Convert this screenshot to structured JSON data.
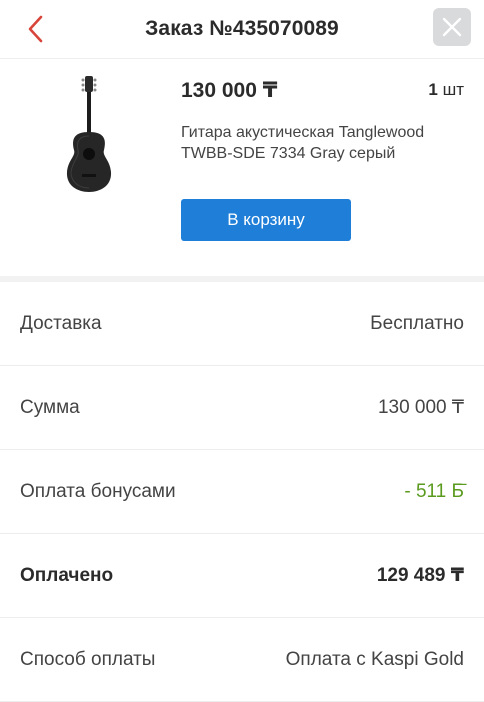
{
  "header": {
    "title": "Заказ №435070089",
    "back_icon": "chevron-left-icon",
    "close_icon": "close-icon",
    "accent_color": "#d8453a"
  },
  "product": {
    "price": "130 000 ₸",
    "quantity": "1",
    "quantity_unit": "шт",
    "name": "Гитара акустическая Tanglewood TWBB-SDE 7334 Gray серый",
    "image": "acoustic-guitar-image",
    "cart_button_label": "В корзину",
    "cart_button_color": "#1f7fd8"
  },
  "summary": [
    {
      "label": "Доставка",
      "value": "Бесплатно"
    },
    {
      "label": "Сумма",
      "value": "130 000 ₸"
    },
    {
      "label": "Оплата бонусами",
      "value": "- 511 Б̄",
      "color": "#5a9a1e"
    },
    {
      "label": "Оплачено",
      "value": "129 489 ₸"
    },
    {
      "label": "Способ оплаты",
      "value": "Оплата с Kaspi Gold"
    }
  ]
}
